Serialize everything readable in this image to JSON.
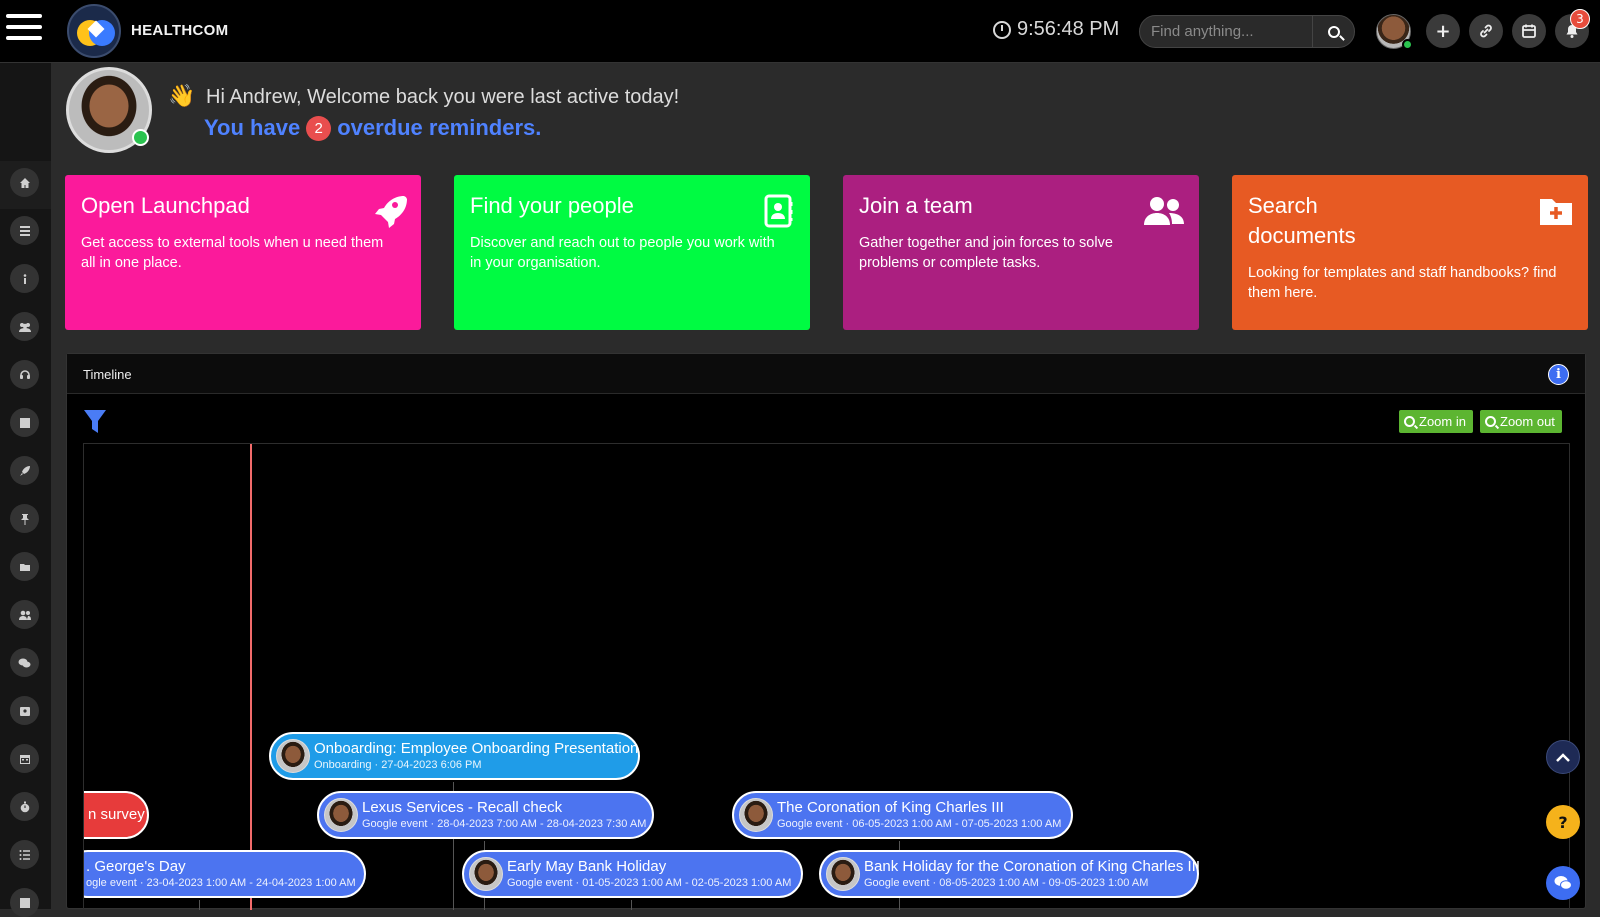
{
  "header": {
    "brand": "HEALTHCOM",
    "time": "9:56:48 PM",
    "search_placeholder": "Find anything...",
    "notification_count": "3"
  },
  "welcome": {
    "greeting": "Hi Andrew, Welcome back you were last active today!",
    "reminder_prefix": "You have",
    "reminder_count": "2",
    "reminder_suffix": "overdue reminders."
  },
  "cards": [
    {
      "title": "Open Launchpad",
      "text": "Get access to external tools when u need them all in one place.",
      "color": "#fb1a9b",
      "icon": "rocket-icon"
    },
    {
      "title": "Find your people",
      "text": "Discover and reach out to people you work with in your organisation.",
      "color": "#00fb42",
      "icon": "contact-book-icon"
    },
    {
      "title": "Join a team",
      "text": "Gather together and join forces to solve problems or complete tasks.",
      "color": "#ab1f80",
      "icon": "users-icon"
    },
    {
      "title": "Search documents",
      "text": "Looking for templates and staff handbooks? find them here.",
      "color": "#e75a23",
      "icon": "folder-plus-icon"
    }
  ],
  "timeline": {
    "title": "Timeline",
    "zoom_in": "Zoom in",
    "zoom_out": "Zoom out",
    "events": [
      {
        "title": "Onboarding: Employee Onboarding Presentation",
        "meta": "Onboarding · 27-04-2023 6:06 PM",
        "style": "cyan"
      },
      {
        "title": "n survey",
        "meta": "",
        "style": "red"
      },
      {
        "title": "Lexus Services - Recall check",
        "meta": "Google event · 28-04-2023 7:00 AM - 28-04-2023 7:30 AM",
        "style": "blue"
      },
      {
        "title": "The Coronation of King Charles III",
        "meta": "Google event · 06-05-2023 1:00 AM - 07-05-2023 1:00 AM",
        "style": "blue"
      },
      {
        "title": ". George's Day",
        "meta": "ogle event · 23-04-2023 1:00 AM - 24-04-2023 1:00 AM",
        "style": "blue"
      },
      {
        "title": "Early May Bank Holiday",
        "meta": "Google event · 01-05-2023 1:00 AM - 02-05-2023 1:00 AM",
        "style": "blue"
      },
      {
        "title": "Bank Holiday for the Coronation of King Charles III",
        "meta": "Google event · 08-05-2023 1:00 AM - 09-05-2023 1:00 AM",
        "style": "blue"
      }
    ]
  },
  "floating": {
    "help": "?"
  }
}
